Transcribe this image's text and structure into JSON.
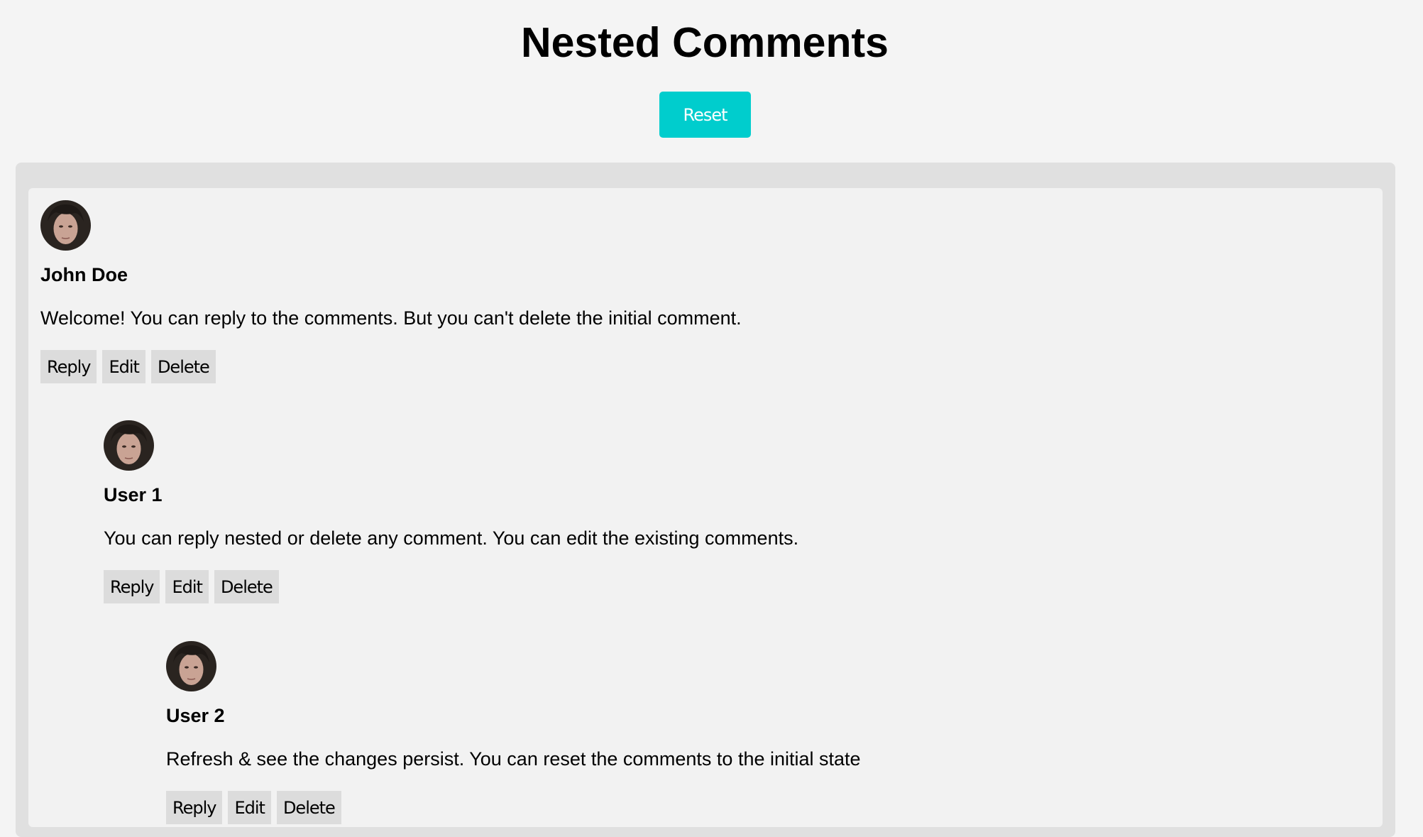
{
  "page": {
    "title": "Nested Comments",
    "reset_label": "Reset",
    "accent_color": "#00cdcd"
  },
  "comments": [
    {
      "author": "John Doe",
      "text": "Welcome! You can reply to the comments. But you can't delete the initial comment.",
      "avatar_icon": "user-avatar",
      "actions": {
        "reply": "Reply",
        "edit": "Edit",
        "delete": "Delete"
      }
    },
    {
      "author": "User 1",
      "text": "You can reply nested or delete any comment. You can edit the existing comments.",
      "avatar_icon": "user-avatar",
      "actions": {
        "reply": "Reply",
        "edit": "Edit",
        "delete": "Delete"
      }
    },
    {
      "author": "User 2",
      "text": "Refresh & see the changes persist. You can reset the comments to the initial state",
      "avatar_icon": "user-avatar",
      "actions": {
        "reply": "Reply",
        "edit": "Edit",
        "delete": "Delete"
      }
    }
  ]
}
